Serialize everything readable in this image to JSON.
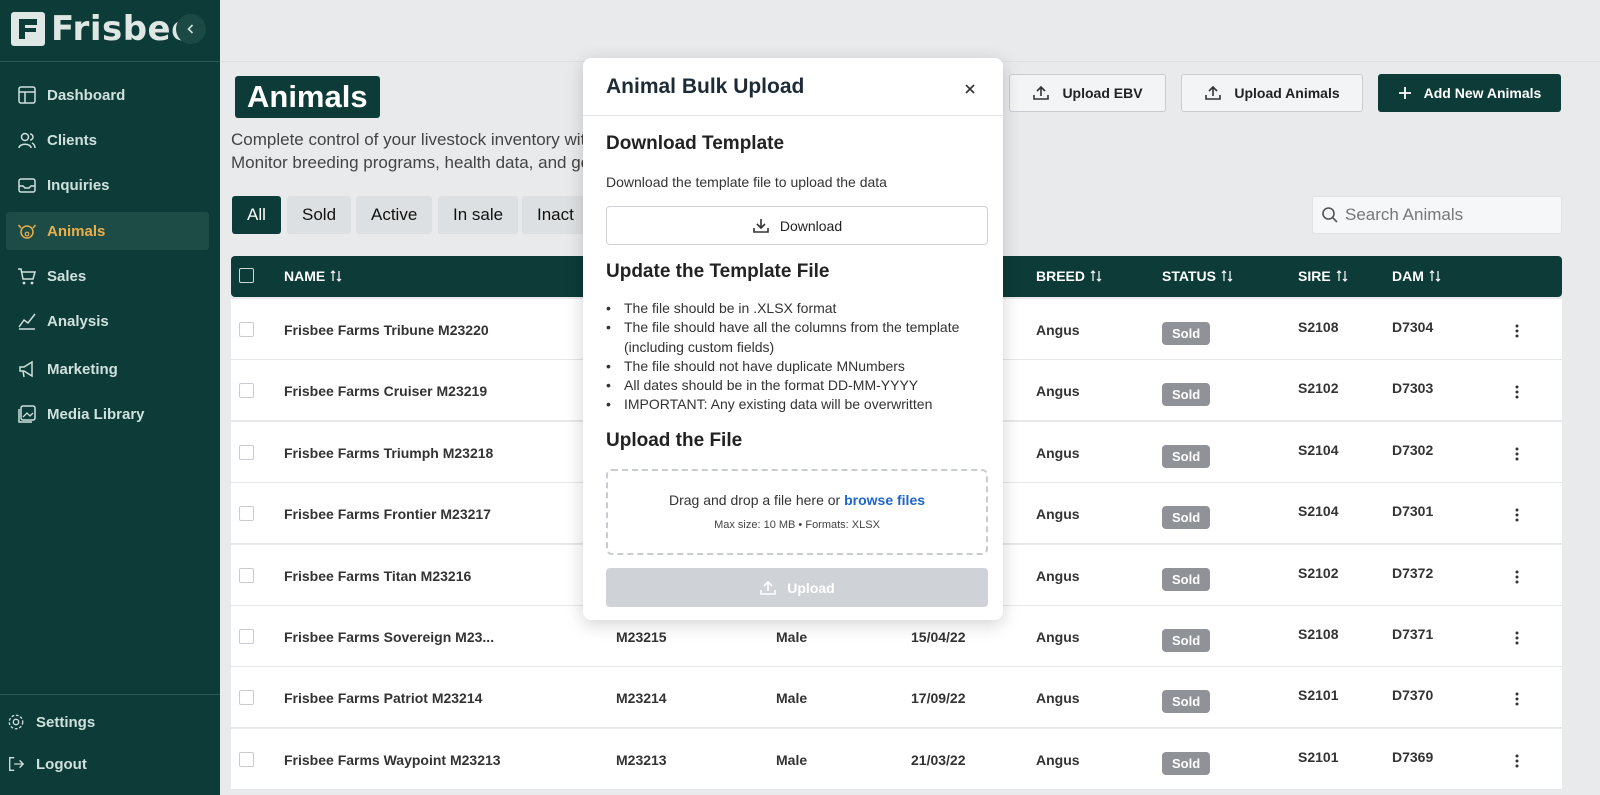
{
  "app": {
    "logo_text": "Frisbee"
  },
  "sidebar": {
    "items": [
      {
        "label": "Dashboard",
        "icon": "dashboard-icon"
      },
      {
        "label": "Clients",
        "icon": "users-icon"
      },
      {
        "label": "Inquiries",
        "icon": "inbox-icon"
      },
      {
        "label": "Animals",
        "icon": "animal-icon",
        "active": true
      },
      {
        "label": "Sales",
        "icon": "cart-icon"
      },
      {
        "label": "Analysis",
        "icon": "chart-icon"
      },
      {
        "label": "Marketing",
        "icon": "megaphone-icon"
      },
      {
        "label": "Media Library",
        "icon": "image-icon"
      }
    ],
    "settings_label": "Settings",
    "logout_label": "Logout"
  },
  "page": {
    "title": "Animals",
    "subtitle_line1": "Complete control of your livestock inventory with",
    "subtitle_line2": "Monitor breeding programs, health data, and gen"
  },
  "header_buttons": {
    "upload_ebv": "Upload EBV",
    "upload_animals": "Upload Animals",
    "add_new": "Add New Animals"
  },
  "filters": [
    "All",
    "Sold",
    "Active",
    "In sale",
    "Inact"
  ],
  "search": {
    "placeholder": "Search Animals"
  },
  "table": {
    "columns": {
      "name": "NAME",
      "breed": "BREED",
      "status": "STATUS",
      "sire": "SIRE",
      "dam": "DAM"
    },
    "rows": [
      {
        "name": "Frisbee Farms Tribune M23220",
        "tag": "",
        "sex": "",
        "dob": "",
        "breed": "Angus",
        "status": "Sold",
        "sire": "S2108",
        "dam": "D7304"
      },
      {
        "name": "Frisbee Farms Cruiser M23219",
        "tag": "",
        "sex": "",
        "dob": "",
        "breed": "Angus",
        "status": "Sold",
        "sire": "S2102",
        "dam": "D7303"
      },
      {
        "name": "Frisbee Farms Triumph M23218",
        "tag": "",
        "sex": "",
        "dob": "",
        "breed": "Angus",
        "status": "Sold",
        "sire": "S2104",
        "dam": "D7302"
      },
      {
        "name": "Frisbee Farms Frontier M23217",
        "tag": "",
        "sex": "",
        "dob": "",
        "breed": "Angus",
        "status": "Sold",
        "sire": "S2104",
        "dam": "D7301"
      },
      {
        "name": "Frisbee Farms Titan M23216",
        "tag": "",
        "sex": "",
        "dob": "",
        "breed": "Angus",
        "status": "Sold",
        "sire": "S2102",
        "dam": "D7372"
      },
      {
        "name": "Frisbee Farms Sovereign M23...",
        "tag": "M23215",
        "sex": "Male",
        "dob": "15/04/22",
        "breed": "Angus",
        "status": "Sold",
        "sire": "S2108",
        "dam": "D7371"
      },
      {
        "name": "Frisbee Farms Patriot M23214",
        "tag": "M23214",
        "sex": "Male",
        "dob": "17/09/22",
        "breed": "Angus",
        "status": "Sold",
        "sire": "S2101",
        "dam": "D7370"
      },
      {
        "name": "Frisbee Farms Waypoint M23213",
        "tag": "M23213",
        "sex": "Male",
        "dob": "21/03/22",
        "breed": "Angus",
        "status": "Sold",
        "sire": "S2101",
        "dam": "D7369"
      }
    ]
  },
  "modal": {
    "title": "Animal Bulk Upload",
    "download_heading": "Download Template",
    "download_text": "Download the template file to upload the data",
    "download_button": "Download",
    "update_heading": "Update the Template File",
    "rules": [
      "The file should be in .XLSX format",
      "The file should have all the columns from the template (including custom fields)",
      "The file should not have duplicate MNumbers",
      "All dates should be in the format DD-MM-YYYY",
      "IMPORTANT: Any existing data will be overwritten"
    ],
    "upload_heading": "Upload the File",
    "drop_text": "Drag and drop a file here or",
    "browse_link": "browse files",
    "drop_sub": "Max size: 10 MB • Formats: XLSX",
    "upload_button": "Upload"
  },
  "colors": {
    "brand": "#0d3b37",
    "accent": "#e9ae4a",
    "link": "#1f64c8",
    "badge": "#8f9398"
  }
}
